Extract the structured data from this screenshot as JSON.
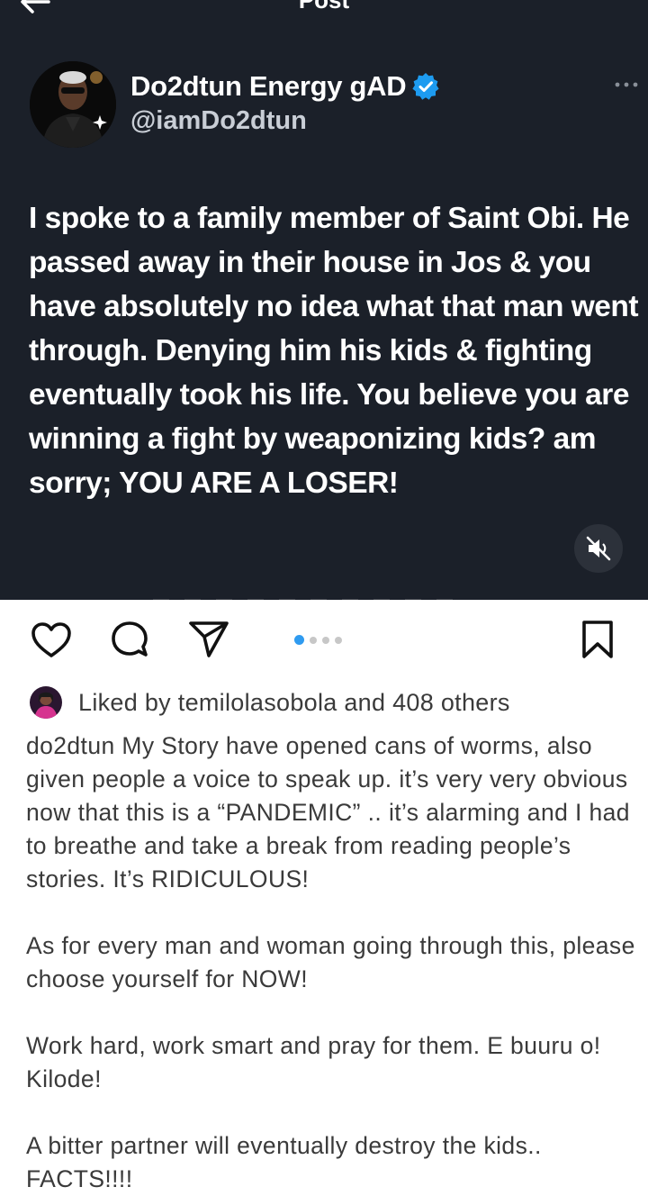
{
  "header": {
    "title": "Post"
  },
  "tweet": {
    "display_name": "Do2dtun Energy gAD",
    "handle": "@iamDo2dtun",
    "text": "I spoke to a family member of Saint Obi. He passed away in their house in Jos & you have absolutely no idea what that man went through. Denying him his kids & fighting eventually took his life. You believe you are winning a fight by weaponizing kids? am sorry; YOU ARE A LOSER!"
  },
  "carousel": {
    "count": 4,
    "active": 0
  },
  "likes": {
    "text": "Liked by temilolasobola and 408 others"
  },
  "caption": {
    "p1": "do2dtun My Story have opened cans of worms, also given people a voice to speak up. it’s very very obvious now that this is a “PANDEMIC” .. it’s alarming and I had to breathe and take a break from reading people’s stories. It’s RIDICULOUS!",
    "p2": "As for every man and woman going through this, please choose yourself for NOW!",
    "p3": "Work hard, work smart and pray for them. E buuru o! Kilode!",
    "p4": "A bitter partner will eventually destroy the kids.. FACTS!!!!"
  },
  "colors": {
    "media_bg": "#1b2029",
    "verified": "#1d9bf0",
    "carousel_active": "#2f9bf0",
    "text": "#3a3a3a"
  },
  "icons": [
    "back-arrow-icon",
    "verified-badge-icon",
    "more-options-icon",
    "mute-icon",
    "heart-icon",
    "comment-icon",
    "share-icon",
    "bookmark-icon"
  ]
}
